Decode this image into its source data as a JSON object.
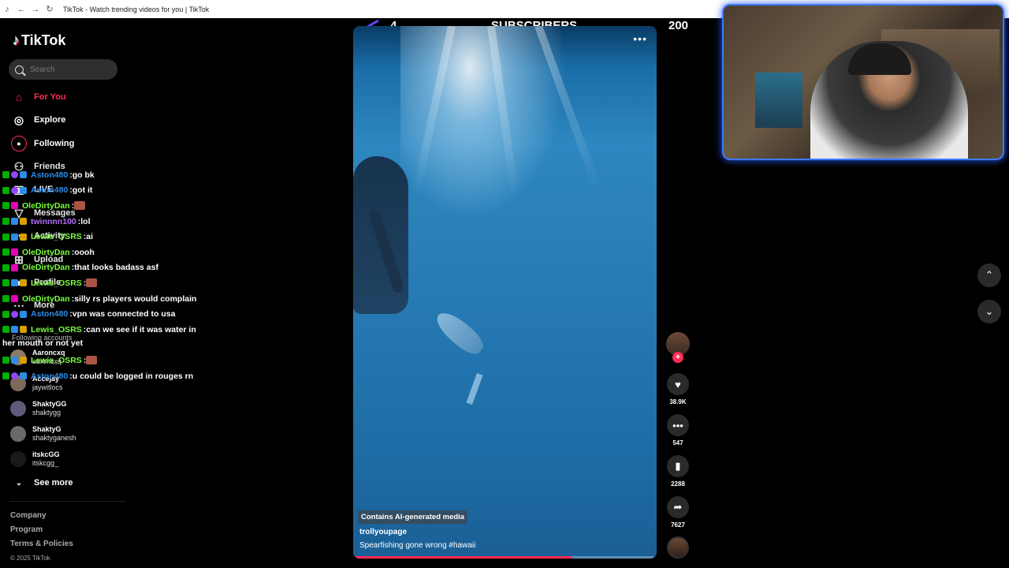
{
  "browser": {
    "tab_title": "TikTok - Watch trending videos for you | TikTok"
  },
  "sidebar": {
    "logo_text": "TikTok",
    "search_placeholder": "Search",
    "nav": [
      {
        "label": "For You",
        "icon": "home-icon"
      },
      {
        "label": "Explore",
        "icon": "compass-icon"
      },
      {
        "label": "Following",
        "icon": "following-avatar-icon"
      },
      {
        "label": "Friends",
        "icon": "friends-icon"
      },
      {
        "label": "LIVE",
        "icon": "live-icon"
      },
      {
        "label": "Messages",
        "icon": "messages-icon"
      },
      {
        "label": "Activity",
        "icon": "activity-icon"
      },
      {
        "label": "Upload",
        "icon": "upload-icon"
      },
      {
        "label": "Profile",
        "icon": "profile-icon"
      },
      {
        "label": "More",
        "icon": "more-icon"
      }
    ],
    "following_accounts_label": "Following accounts",
    "accounts": [
      {
        "name": "Aaroncxq",
        "handle": "aaroncxq"
      },
      {
        "name": "Accejay",
        "handle": "jaywitlocs"
      },
      {
        "name": "ShaktyGG",
        "handle": "shaktygg"
      },
      {
        "name": "ShaktyG",
        "handle": "shaktyganesh"
      },
      {
        "name": "itskcGG",
        "handle": "itskcgg_"
      }
    ],
    "see_more": "See more",
    "footer": [
      "Company",
      "Program",
      "Terms & Policies"
    ],
    "copyright": "© 2025 TikTok"
  },
  "chat": [
    {
      "user": "Aston480",
      "color": "#2d8ce6",
      "msg": "go bk"
    },
    {
      "user": "Aston480",
      "color": "#2d8ce6",
      "msg": "got it"
    },
    {
      "user": "OleDirtyDan",
      "color": "#7cff3c",
      "msg": ""
    },
    {
      "user": "twinnnn100",
      "color": "#b46bff",
      "msg": "lol"
    },
    {
      "user": "Lewis_OSRS",
      "color": "#7cff3c",
      "msg": "ai"
    },
    {
      "user": "OleDirtyDan",
      "color": "#7cff3c",
      "msg": "oooh"
    },
    {
      "user": "OleDirtyDan",
      "color": "#7cff3c",
      "msg": "that looks badass asf"
    },
    {
      "user": "Lewis_OSRS",
      "color": "#7cff3c",
      "msg": ""
    },
    {
      "user": "OleDirtyDan",
      "color": "#7cff3c",
      "msg": "silly rs players would complain"
    },
    {
      "user": "Aston480",
      "color": "#2d8ce6",
      "msg": "vpn was connected to usa"
    },
    {
      "user": "Lewis_OSRS",
      "color": "#7cff3c",
      "msg": "can we see if it was water in"
    },
    {
      "user": "Lewis_OSRS",
      "color": "#7cff3c",
      "msg": ""
    },
    {
      "user": "Aston480",
      "color": "#2d8ce6",
      "msg": "u could be logged in rouges rn"
    }
  ],
  "chat_wrap": "her mouth or not yet",
  "subgoal": {
    "current": "4",
    "label": "SUBSCRIBERS",
    "goal": "200"
  },
  "video": {
    "ai_label": "Contains AI-generated media",
    "author": "trollyoupage",
    "caption": "Spearfishing gone wrong #hawaii",
    "progress": 0.72
  },
  "actions": {
    "likes": "38.9K",
    "comments": "547",
    "saves": "2288",
    "shares": "7627"
  },
  "colors": {
    "accent": "#fe2c55",
    "webcam_border": "#3c7bff"
  }
}
